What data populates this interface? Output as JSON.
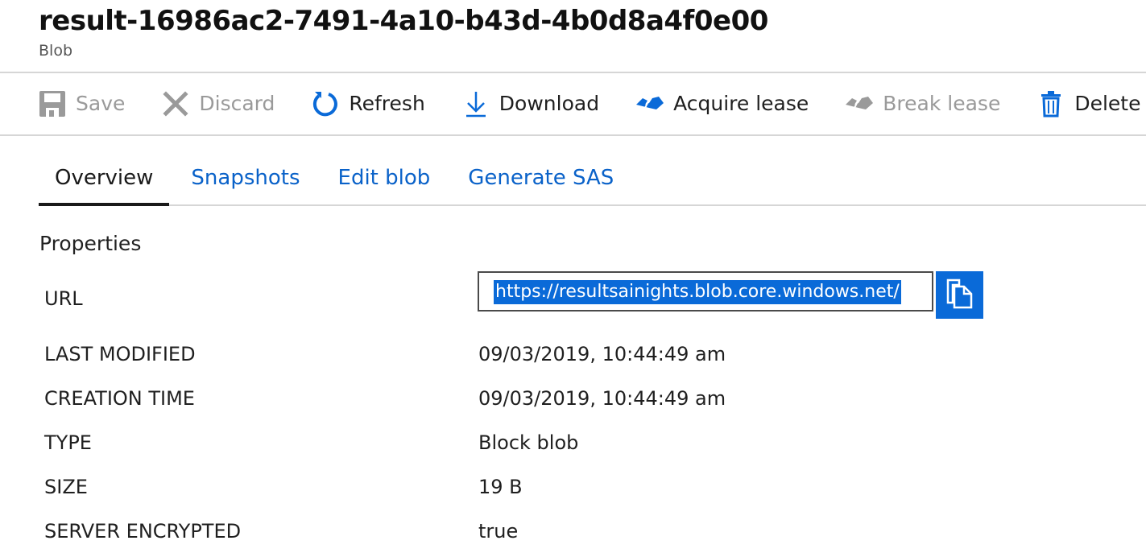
{
  "header": {
    "title": "result-16986ac2-7491-4a10-b43d-4b0d8a4f0e00",
    "subtitle": "Blob"
  },
  "toolbar": {
    "save_label": "Save",
    "discard_label": "Discard",
    "refresh_label": "Refresh",
    "download_label": "Download",
    "acquire_lease_label": "Acquire lease",
    "break_lease_label": "Break lease",
    "delete_label": "Delete"
  },
  "tabs": [
    {
      "label": "Overview",
      "active": true
    },
    {
      "label": "Snapshots",
      "active": false
    },
    {
      "label": "Edit blob",
      "active": false
    },
    {
      "label": "Generate SAS",
      "active": false
    }
  ],
  "properties": {
    "section_title": "Properties",
    "url_label": "URL",
    "url_value": "https://resultsainights.blob.core.windows.net/",
    "rows": [
      {
        "key": "LAST MODIFIED",
        "value": "09/03/2019, 10:44:49 am"
      },
      {
        "key": "CREATION TIME",
        "value": "09/03/2019, 10:44:49 am"
      },
      {
        "key": "TYPE",
        "value": "Block blob"
      },
      {
        "key": "SIZE",
        "value": "19 B"
      },
      {
        "key": "SERVER ENCRYPTED",
        "value": "true"
      }
    ]
  },
  "colors": {
    "accent": "#0a6ad8",
    "link": "#0a62c9",
    "disabled": "#9a9a9a",
    "divider": "#d6d6d6"
  },
  "icons": [
    "save-icon",
    "close-icon",
    "refresh-icon",
    "download-icon",
    "acquire-lease-icon",
    "break-lease-icon",
    "trash-icon",
    "copy-icon"
  ]
}
